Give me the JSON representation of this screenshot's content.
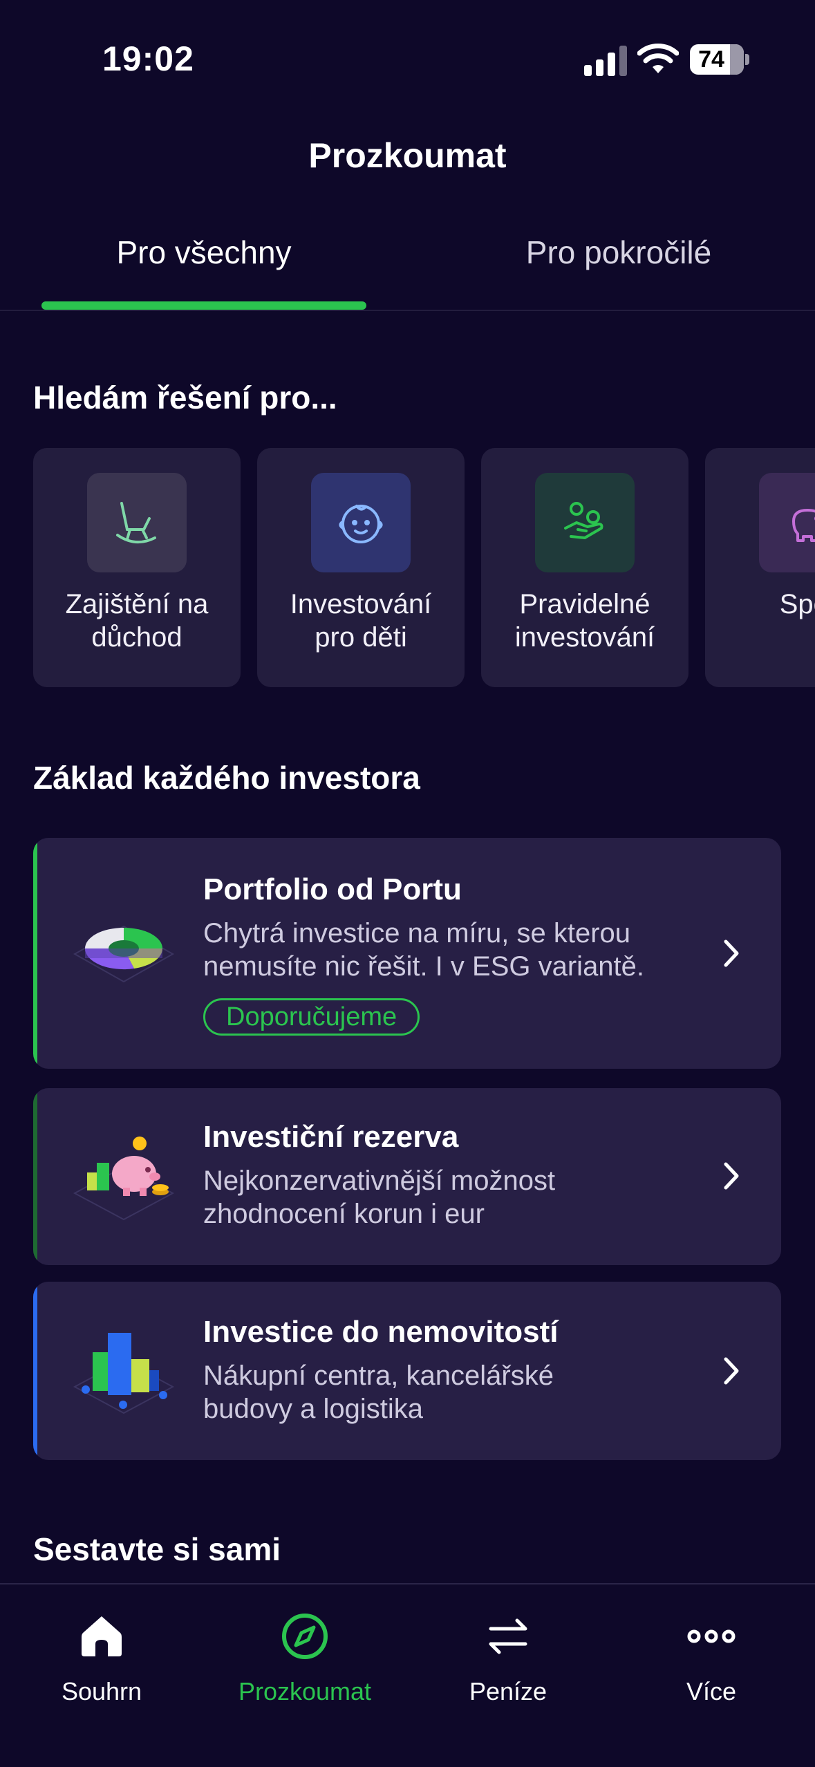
{
  "status_bar": {
    "time": "19:02",
    "battery": "74"
  },
  "header": {
    "title": "Prozkoumat"
  },
  "tabs": [
    {
      "label": "Pro všechny",
      "active": true
    },
    {
      "label": "Pro pokročilé",
      "active": false
    }
  ],
  "solutions": {
    "title": "Hledám řešení pro...",
    "items": [
      {
        "line1": "Zajištění na",
        "line2": "důchod",
        "icon": "rocking-chair-icon",
        "color": "#7fd8a8"
      },
      {
        "line1": "Investování",
        "line2": "pro děti",
        "icon": "baby-face-icon",
        "color": "#8ab8ff"
      },
      {
        "line1": "Pravidelné",
        "line2": "investování",
        "icon": "hand-coins-icon",
        "color": "#2bc44f"
      },
      {
        "line1": "Spoř",
        "line2": "",
        "icon": "piggy-bank-icon",
        "color": "#c46fd8"
      }
    ]
  },
  "basics": {
    "title": "Základ každého investora",
    "products": [
      {
        "title": "Portfolio od Portu",
        "desc1": "Chytrá investice na míru, se kterou",
        "desc2": "nemusíte nic řešit. I v ESG variantě.",
        "badge": "Doporučujeme",
        "accent": "#2bc44f",
        "icon": "pie-chart-illustration"
      },
      {
        "title": "Investiční rezerva",
        "desc1": "Nejkonzervativnější možnost",
        "desc2": "zhodnocení korun i eur",
        "accent": "#1e6b32",
        "icon": "piggy-bank-illustration"
      },
      {
        "title": "Investice do nemovitostí",
        "desc1": "Nákupní centra, kancelářské",
        "desc2": "budovy a logistika",
        "accent": "#2b6bf0",
        "icon": "buildings-illustration"
      }
    ]
  },
  "diy": {
    "title": "Sestavte si sami"
  },
  "bottom_nav": [
    {
      "label": "Souhrn",
      "icon": "home-icon",
      "active": false
    },
    {
      "label": "Prozkoumat",
      "icon": "compass-icon",
      "active": true
    },
    {
      "label": "Peníze",
      "icon": "transfer-arrows-icon",
      "active": false
    },
    {
      "label": "Více",
      "icon": "more-dots-icon",
      "active": false
    }
  ],
  "colors": {
    "background": "#0e0829",
    "card": "#271f45",
    "accent_green": "#2bc44f"
  }
}
